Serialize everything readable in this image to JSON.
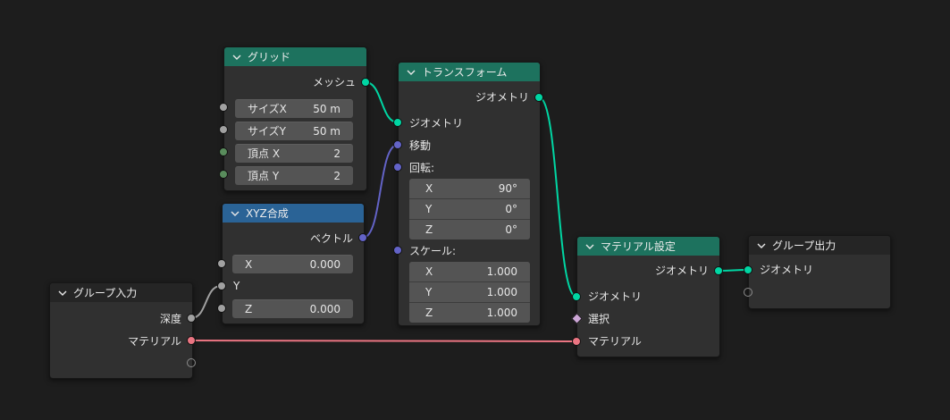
{
  "nodes": {
    "grid": {
      "title": "グリッド",
      "output_mesh": "メッシュ",
      "fields": [
        {
          "label": "サイズX",
          "value": "50 m"
        },
        {
          "label": "サイズY",
          "value": "50 m"
        },
        {
          "label": "頂点 X",
          "value": "2"
        },
        {
          "label": "頂点 Y",
          "value": "2"
        }
      ]
    },
    "combine_xyz": {
      "title": "XYZ合成",
      "output_vector": "ベクトル",
      "x": {
        "label": "X",
        "value": "0.000"
      },
      "y_label": "Y",
      "z": {
        "label": "Z",
        "value": "0.000"
      }
    },
    "transform": {
      "title": "トランスフォーム",
      "output_geometry": "ジオメトリ",
      "input_geometry": "ジオメトリ",
      "input_translation": "移動",
      "rotation_label": "回転:",
      "rotation": [
        {
          "label": "X",
          "value": "90°"
        },
        {
          "label": "Y",
          "value": "0°"
        },
        {
          "label": "Z",
          "value": "0°"
        }
      ],
      "scale_label": "スケール:",
      "scale": [
        {
          "label": "X",
          "value": "1.000"
        },
        {
          "label": "Y",
          "value": "1.000"
        },
        {
          "label": "Z",
          "value": "1.000"
        }
      ]
    },
    "group_input": {
      "title": "グループ入力",
      "output_depth": "深度",
      "output_material": "マテリアル"
    },
    "set_material": {
      "title": "マテリアル設定",
      "output_geometry": "ジオメトリ",
      "input_geometry": "ジオメトリ",
      "input_selection": "選択",
      "input_material": "マテリアル"
    },
    "group_output": {
      "title": "グループ出力",
      "input_geometry": "ジオメトリ"
    }
  },
  "colors": {
    "background": "#1d1d1d",
    "geometry_socket": "#00d6a3",
    "vector_socket": "#6363c7",
    "float_socket": "#a1a1a1",
    "integer_socket": "#598c5c",
    "material_socket": "#eb7582",
    "boolean_socket": "#cca6d6",
    "geometry_header": "#1d725e",
    "vector_header": "#2a6396",
    "group_header": "#252525"
  },
  "icons": {
    "collapse": "chevron-down-icon"
  }
}
